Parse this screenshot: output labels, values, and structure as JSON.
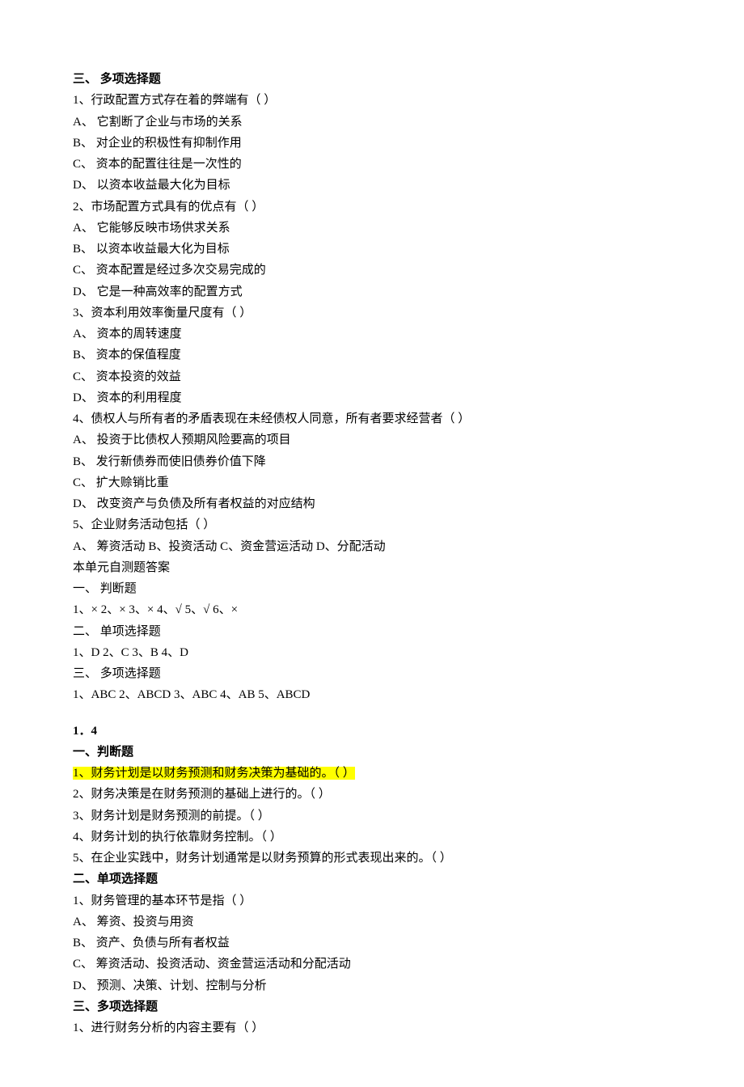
{
  "block1": {
    "heading": "三、 多项选择题",
    "q1": {
      "stem": "1、行政配置方式存在着的弊端有（ ）",
      "A": "A、 它割断了企业与市场的关系",
      "B": "B、 对企业的积极性有抑制作用",
      "C": "C、 资本的配置往往是一次性的",
      "D": "D、 以资本收益最大化为目标"
    },
    "q2": {
      "stem": "2、市场配置方式具有的优点有（ ）",
      "A": "A、 它能够反映市场供求关系",
      "B": "B、 以资本收益最大化为目标",
      "C": "C、 资本配置是经过多次交易完成的",
      "D": "D、 它是一种高效率的配置方式"
    },
    "q3": {
      "stem": "3、资本利用效率衡量尺度有（ ）",
      "A": "A、 资本的周转速度",
      "B": "B、 资本的保值程度",
      "C": "C、 资本投资的效益",
      "D": "D、 资本的利用程度"
    },
    "q4": {
      "stem": "4、债权人与所有者的矛盾表现在未经债权人同意，所有者要求经营者（ ）",
      "A": "A、 投资于比债权人预期风险要高的项目",
      "B": "B、 发行新债券而使旧债券价值下降",
      "C": "C、 扩大赊销比重",
      "D": "D、 改变资产与负债及所有者权益的对应结构"
    },
    "q5": {
      "stem": "5、企业财务活动包括（ ）",
      "opts": "A、 筹资活动 B、投资活动 C、资金营运活动 D、分配活动"
    }
  },
  "answers": {
    "header": "本单元自测题答案",
    "s1h": "一、 判断题",
    "s1a": "1、× 2、× 3、× 4、√ 5、√ 6、×",
    "s2h": "二、 单项选择题",
    "s2a": "1、D 2、C 3、B 4、D",
    "s3h": "三、 多项选择题",
    "s3a": "1、ABC 2、ABCD 3、ABC 4、AB 5、ABCD"
  },
  "block2": {
    "unit": "1．4",
    "s1h": "一、判断题",
    "s1q1": "1、财务计划是以财务预测和财务决策为基础的。（ ）",
    "s1q2": "2、财务决策是在财务预测的基础上进行的。（ ）",
    "s1q3": "3、财务计划是财务预测的前提。（ ）",
    "s1q4": "4、财务计划的执行依靠财务控制。（ ）",
    "s1q5": "5、在企业实践中，财务计划通常是以财务预算的形式表现出来的。（ ）",
    "s2h": "二、单项选择题",
    "s2q1": {
      "stem": "1、财务管理的基本环节是指（ ）",
      "A": "A、 筹资、投资与用资",
      "B": "B、 资产、负债与所有者权益",
      "C": "C、 筹资活动、投资活动、资金营运活动和分配活动",
      "D": "D、 预测、决策、计划、控制与分析"
    },
    "s3h": "三、多项选择题",
    "s3q1": "1、进行财务分析的内容主要有（ ）"
  }
}
